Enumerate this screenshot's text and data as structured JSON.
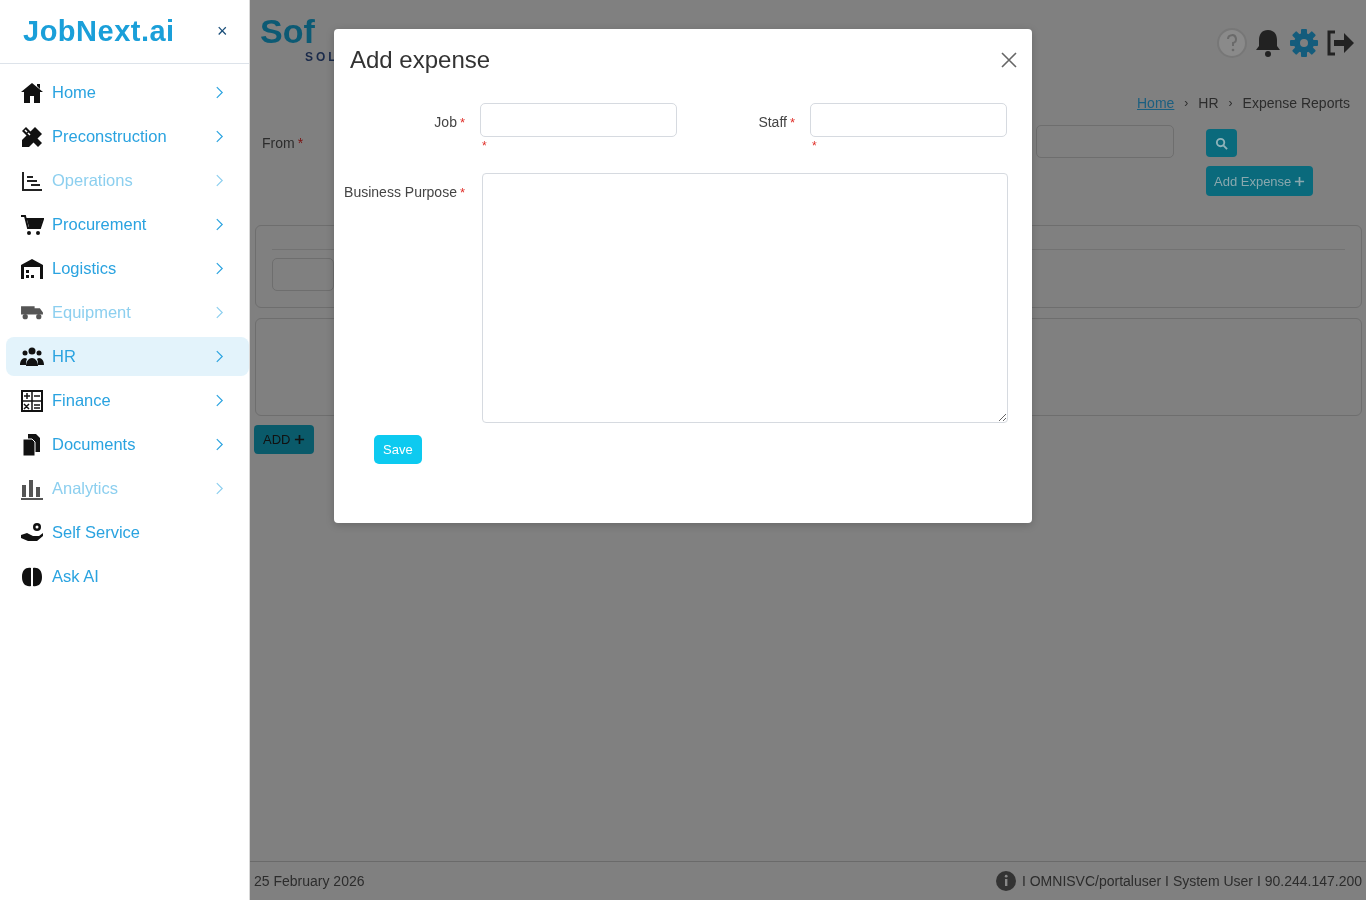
{
  "sidebar": {
    "logo": "JobNext.ai",
    "close": "×",
    "items": [
      {
        "label": "Home",
        "dimmed": false,
        "selected": false,
        "expandable": true
      },
      {
        "label": "Preconstruction",
        "dimmed": false,
        "selected": false,
        "expandable": true
      },
      {
        "label": "Operations",
        "dimmed": true,
        "selected": false,
        "expandable": true
      },
      {
        "label": "Procurement",
        "dimmed": false,
        "selected": false,
        "expandable": true
      },
      {
        "label": "Logistics",
        "dimmed": false,
        "selected": false,
        "expandable": true
      },
      {
        "label": "Equipment",
        "dimmed": true,
        "selected": false,
        "expandable": true
      },
      {
        "label": "HR",
        "dimmed": false,
        "selected": true,
        "expandable": true
      },
      {
        "label": "Finance",
        "dimmed": false,
        "selected": false,
        "expandable": true
      },
      {
        "label": "Documents",
        "dimmed": false,
        "selected": false,
        "expandable": true
      },
      {
        "label": "Analytics",
        "dimmed": true,
        "selected": false,
        "expandable": true
      },
      {
        "label": "Self Service",
        "dimmed": false,
        "selected": false,
        "expandable": false
      },
      {
        "label": "Ask AI",
        "dimmed": false,
        "selected": false,
        "expandable": false
      }
    ]
  },
  "page": {
    "brand": {
      "name": "Sof",
      "tagline": "SOL"
    },
    "breadcrumbs": [
      {
        "label": "Home",
        "link": true
      },
      {
        "separator": "›",
        "label": "HR",
        "link": false
      },
      {
        "separator": "›",
        "label": "Expense Reports",
        "link": false
      }
    ],
    "filter": {
      "label": "From",
      "mark": "*"
    },
    "add_expense": "Add Expense",
    "add_button": "ADD"
  },
  "modal": {
    "title": "Add expense",
    "fields": [
      {
        "kind": "input",
        "label": "Job",
        "mark": "*",
        "error": "*"
      },
      {
        "kind": "input",
        "label": "Staff",
        "mark": "*",
        "error": "*"
      },
      {
        "kind": "textarea",
        "label": "Business Purpose",
        "mark": "*"
      }
    ],
    "save": "Save"
  },
  "footer": {
    "date": "25 February 2026",
    "info": "I OMNISVC/portaluser I System User I 90.244.147.200"
  }
}
